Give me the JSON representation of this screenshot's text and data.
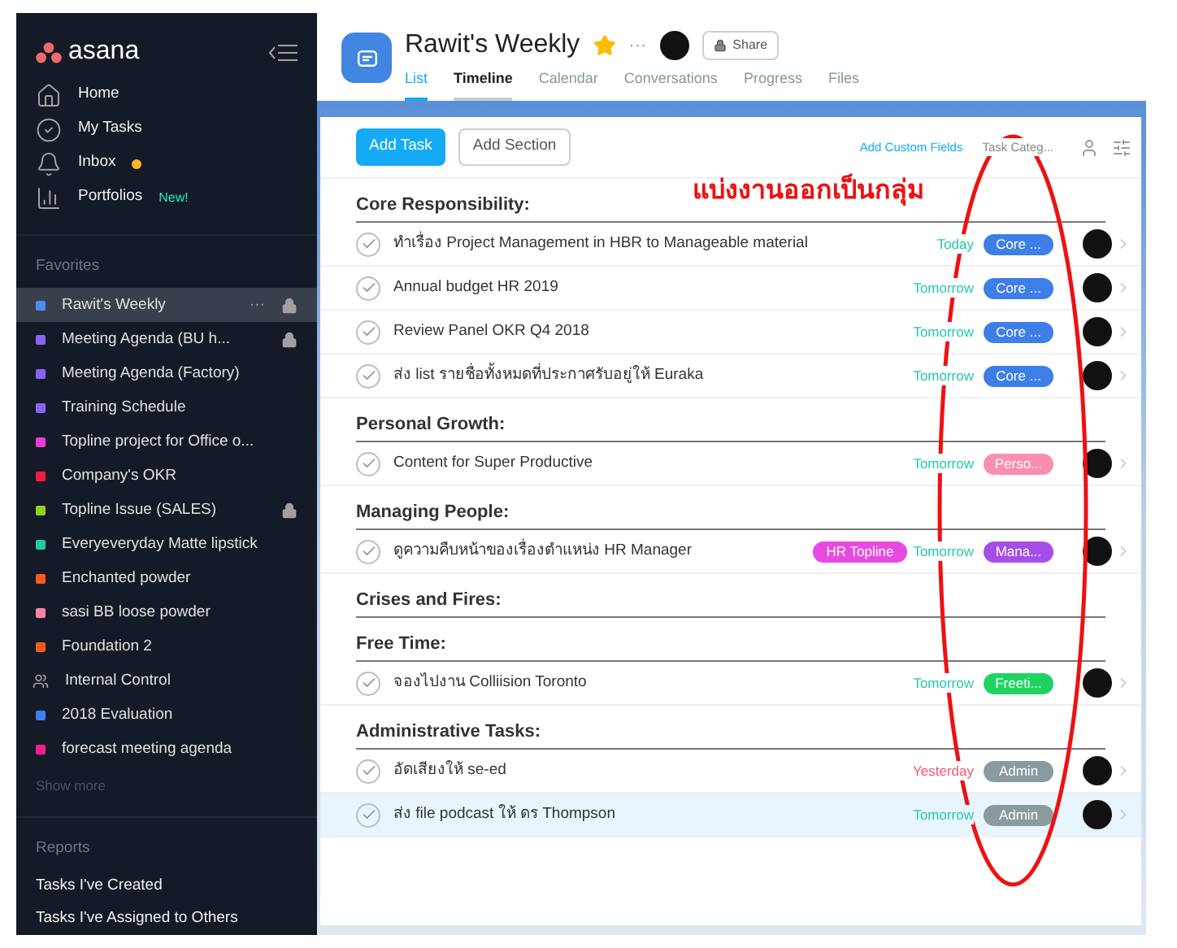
{
  "sidebar": {
    "logo": "asana",
    "nav": [
      {
        "kind": "home",
        "label": "Home"
      },
      {
        "kind": "tasks",
        "label": "My Tasks"
      },
      {
        "kind": "inbox",
        "label": "Inbox",
        "dot": true
      },
      {
        "kind": "portfolios",
        "label": "Portfolios",
        "badge": "New!"
      }
    ],
    "favorites_heading": "Favorites",
    "favorites": [
      {
        "kind": "project",
        "label": "Rawit's Weekly",
        "color": "#4a8df0",
        "selected": true,
        "more": "···",
        "locked": true
      },
      {
        "kind": "project",
        "label": "Meeting Agenda (BU h...",
        "color": "#8a63f5",
        "selected": false,
        "locked": true
      },
      {
        "kind": "project",
        "label": "Meeting Agenda (Factory)",
        "color": "#8a63f5",
        "selected": false,
        "locked": false
      },
      {
        "kind": "project",
        "label": "Training Schedule",
        "color": "#8a63f5",
        "selected": false,
        "locked": false
      },
      {
        "kind": "project",
        "label": "Topline project for Office o...",
        "color": "#ec3ddb",
        "selected": false,
        "locked": false
      },
      {
        "kind": "project",
        "label": "Company's OKR",
        "color": "#ef1c45",
        "selected": false,
        "locked": false
      },
      {
        "kind": "project",
        "label": "Topline Issue (SALES)",
        "color": "#8fd21f",
        "selected": false,
        "locked": true
      },
      {
        "kind": "project",
        "label": "Everyeveryday Matte lipstick",
        "color": "#1ecba5",
        "selected": false,
        "locked": false
      },
      {
        "kind": "project",
        "label": "Enchanted powder",
        "color": "#f5591f",
        "selected": false,
        "locked": false
      },
      {
        "kind": "project",
        "label": "sasi BB loose powder",
        "color": "#f783a6",
        "selected": false,
        "locked": false
      },
      {
        "kind": "project",
        "label": "Foundation 2",
        "color": "#f5591f",
        "selected": false,
        "locked": false
      },
      {
        "kind": "team",
        "label": "Internal Control",
        "selected": false,
        "locked": false
      },
      {
        "kind": "project",
        "label": "2018 Evaluation",
        "color": "#3e7ef0",
        "selected": false,
        "locked": false
      },
      {
        "kind": "project",
        "label": "forecast meeting agenda",
        "color": "#f21f8c",
        "selected": false,
        "locked": false
      }
    ],
    "show_more": "Show more",
    "reports_heading": "Reports",
    "reports": [
      "Tasks I've Created",
      "Tasks I've Assigned to Others"
    ]
  },
  "project": {
    "title": "Rawit's Weekly",
    "starred": true,
    "more": "···",
    "share": "Share",
    "tabs": [
      {
        "label": "List",
        "selected": true,
        "hovered": false
      },
      {
        "label": "Timeline",
        "selected": false,
        "hovered": true
      },
      {
        "label": "Calendar",
        "selected": false,
        "hovered": false
      },
      {
        "label": "Conversations",
        "selected": false,
        "hovered": false
      },
      {
        "label": "Progress",
        "selected": false,
        "hovered": false
      },
      {
        "label": "Files",
        "selected": false,
        "hovered": false
      }
    ]
  },
  "toolbar": {
    "add_task": "Add Task",
    "add_section": "Add Section",
    "add_custom_fields": "Add Custom Fields",
    "task_category": "Task Categ..."
  },
  "sections": [
    {
      "title": "Core Responsibility:",
      "tasks": [
        {
          "name": "ทำเรื่อง Project Management in HBR to Manageable material",
          "due": "Today",
          "overdue": false,
          "tags": [
            {
              "label": "Core ...",
              "color": "#3e7ee8"
            }
          ],
          "selected": false
        },
        {
          "name": "Annual budget HR 2019",
          "due": "Tomorrow",
          "overdue": false,
          "tags": [
            {
              "label": "Core ...",
              "color": "#3e7ee8"
            }
          ],
          "selected": false
        },
        {
          "name": "Review Panel OKR Q4 2018",
          "due": "Tomorrow",
          "overdue": false,
          "tags": [
            {
              "label": "Core ...",
              "color": "#3e7ee8"
            }
          ],
          "selected": false
        },
        {
          "name": "ส่ง list รายชื่อทั้งหมดที่ประกาศรับอยู่ให้ Euraka",
          "due": "Tomorrow",
          "overdue": false,
          "tags": [
            {
              "label": "Core ...",
              "color": "#3e7ee8"
            }
          ],
          "selected": false
        }
      ]
    },
    {
      "title": "Personal Growth:",
      "tasks": [
        {
          "name": "Content for Super Productive",
          "due": "Tomorrow",
          "overdue": false,
          "tags": [
            {
              "label": "Perso...",
              "color": "#f98eae"
            }
          ],
          "selected": false
        }
      ]
    },
    {
      "title": "Managing People:",
      "tasks": [
        {
          "name": "ดูความคืบหน้าของเรื่องตำแหน่ง HR Manager",
          "labels": [
            {
              "label": "HR Topline",
              "color": "#e84ae0"
            }
          ],
          "due": "Tomorrow",
          "overdue": false,
          "tags": [
            {
              "label": "Mana...",
              "color": "#a54ee8"
            }
          ],
          "selected": false
        }
      ]
    },
    {
      "title": "Crises and Fires:"
    },
    {
      "title": "Free Time:",
      "tasks": [
        {
          "name": "จองไปงาน Colliision Toronto",
          "due": "Tomorrow",
          "overdue": false,
          "tags": [
            {
              "label": "Freeti...",
              "color": "#1fd363"
            }
          ],
          "selected": false
        }
      ]
    },
    {
      "title": "Administrative Tasks:",
      "tasks": [
        {
          "name": "อัดเสียงให้ se-ed",
          "due": "Yesterday",
          "overdue": true,
          "tags": [
            {
              "label": "Admin",
              "color": "#8a9ba0"
            }
          ],
          "selected": false
        },
        {
          "name": "ส่ง file podcast ให้ ดร Thompson",
          "due": "Tomorrow",
          "overdue": false,
          "tags": [
            {
              "label": "Admin",
              "color": "#8a9ba0"
            }
          ],
          "selected": true
        }
      ]
    }
  ],
  "annotation": {
    "text": "แบ่งงานออกเป็นกลุ่ม"
  }
}
